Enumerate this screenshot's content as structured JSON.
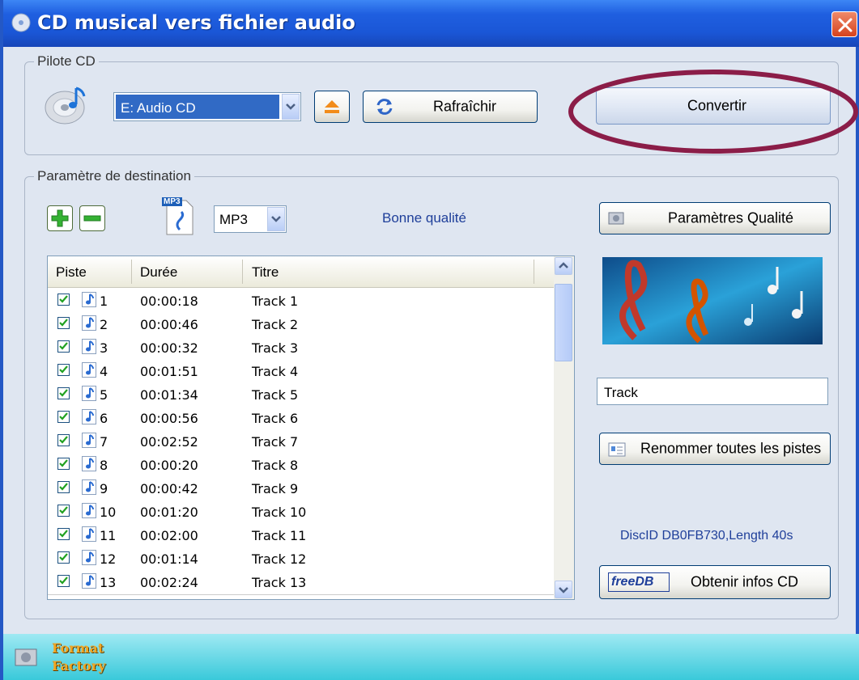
{
  "window": {
    "title": "CD musical vers fichier audio"
  },
  "pilote": {
    "legend": "Pilote CD",
    "drive_value": "E:  Audio CD",
    "refresh_label": "Rafraîchir",
    "convert_label": "Convertir"
  },
  "destination": {
    "legend": "Paramètre de destination",
    "format_value": "MP3",
    "format_badge": "MP3",
    "quality_text": "Bonne qualité",
    "quality_button": "Paramètres Qualité"
  },
  "tracklist": {
    "columns": [
      "Piste",
      "Durée",
      "Titre"
    ],
    "rows": [
      {
        "num": "1",
        "dur": "00:00:18",
        "title": "Track 1"
      },
      {
        "num": "2",
        "dur": "00:00:46",
        "title": "Track 2"
      },
      {
        "num": "3",
        "dur": "00:00:32",
        "title": "Track 3"
      },
      {
        "num": "4",
        "dur": "00:01:51",
        "title": "Track 4"
      },
      {
        "num": "5",
        "dur": "00:01:34",
        "title": "Track 5"
      },
      {
        "num": "6",
        "dur": "00:00:56",
        "title": "Track 6"
      },
      {
        "num": "7",
        "dur": "00:02:52",
        "title": "Track 7"
      },
      {
        "num": "8",
        "dur": "00:00:20",
        "title": "Track 8"
      },
      {
        "num": "9",
        "dur": "00:00:42",
        "title": "Track 9"
      },
      {
        "num": "10",
        "dur": "00:01:20",
        "title": "Track 10"
      },
      {
        "num": "11",
        "dur": "00:02:00",
        "title": "Track 11"
      },
      {
        "num": "12",
        "dur": "00:01:14",
        "title": "Track 12"
      },
      {
        "num": "13",
        "dur": "00:02:24",
        "title": "Track 13"
      }
    ]
  },
  "rename": {
    "input_value": "Track",
    "button_label": "Renommer toutes les pistes"
  },
  "disc": {
    "info": "DiscID DB0FB730,Length 40s",
    "freedb_logo": "freeDB",
    "get_info_label": "Obtenir infos CD"
  },
  "footer": {
    "app_name_line1": "Format",
    "app_name_line2": "Factory"
  },
  "colors": {
    "titlebar": "#1f5fe0",
    "accent_text": "#1f3f9a",
    "highlight_ellipse": "#8b1d48",
    "selection": "#316ac5"
  }
}
